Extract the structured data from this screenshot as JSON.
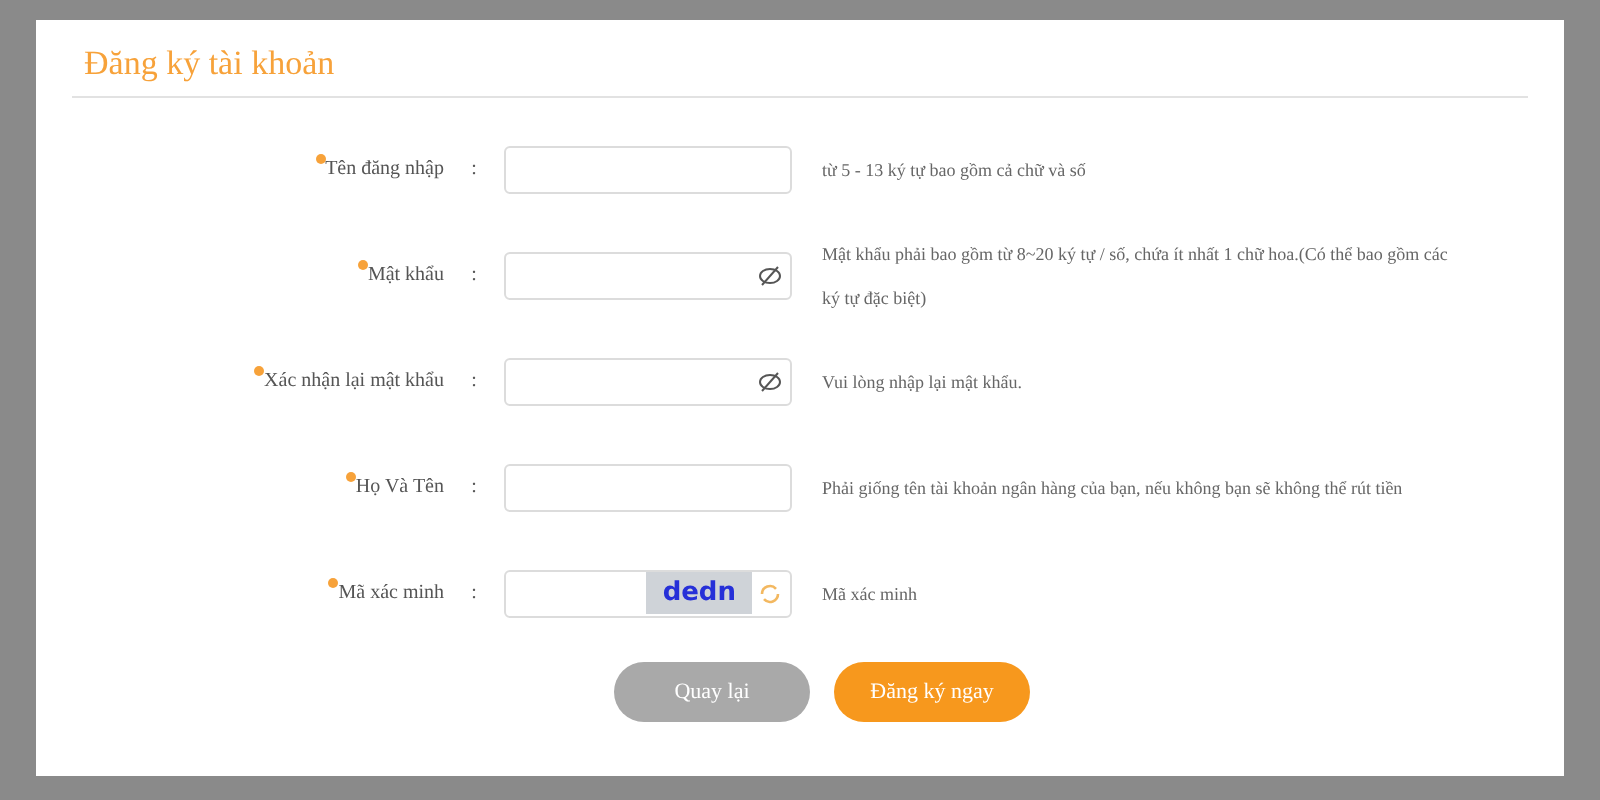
{
  "title": "Đăng ký tài khoản",
  "fields": [
    {
      "kind": "text",
      "label": "Tên đăng nhập",
      "required": true,
      "hint": "từ 5 - 13 ký tự bao gồm cả chữ và số"
    },
    {
      "kind": "password",
      "label": "Mật khẩu",
      "required": true,
      "hint": "Mật khẩu phải bao gồm từ 8~20 ký tự / số, chứa ít nhất 1 chữ hoa.(Có thể bao gồm các ký tự đặc biệt)"
    },
    {
      "kind": "password",
      "label": "Xác nhận lại mật khẩu",
      "required": true,
      "hint": "Vui lòng nhập lại mật khẩu."
    },
    {
      "kind": "text",
      "label": "Họ Và Tên",
      "required": true,
      "hint": "Phải giống tên tài khoản ngân hàng của bạn, nếu không bạn sẽ không thể rút tiền"
    },
    {
      "kind": "captcha",
      "label": "Mã xác minh",
      "required": true,
      "captcha": "dedn",
      "hint": "Mã xác minh"
    }
  ],
  "separator": ":",
  "buttons": [
    {
      "kind": "secondary",
      "label": "Quay lại"
    },
    {
      "kind": "primary",
      "label": "Đăng ký ngay"
    }
  ]
}
